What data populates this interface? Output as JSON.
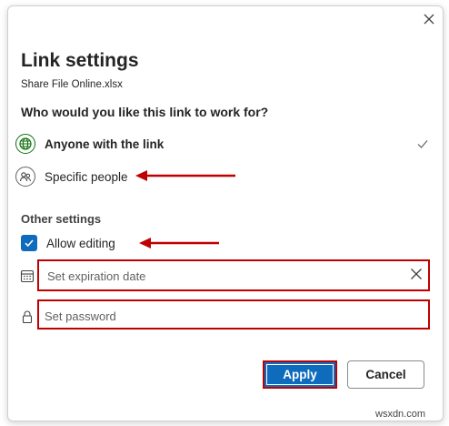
{
  "dialog": {
    "title": "Link settings",
    "file_name": "Share File Online.xlsx",
    "question": "Who would you like this link to work for?",
    "options": [
      {
        "label": "Anyone with the link",
        "selected": true,
        "icon": "globe-icon"
      },
      {
        "label": "Specific people",
        "selected": false,
        "icon": "people-icon"
      }
    ],
    "other_settings": {
      "heading": "Other settings",
      "allow_editing": {
        "label": "Allow editing",
        "checked": true
      },
      "expiration": {
        "placeholder": "Set expiration date",
        "value": ""
      },
      "password": {
        "placeholder": "Set password",
        "value": ""
      }
    },
    "buttons": {
      "apply": "Apply",
      "cancel": "Cancel"
    }
  },
  "watermark": "wsxdn.com",
  "colors": {
    "accent": "#0f6cbd",
    "annotation": "#c00000",
    "selected_icon": "#0e700e"
  }
}
